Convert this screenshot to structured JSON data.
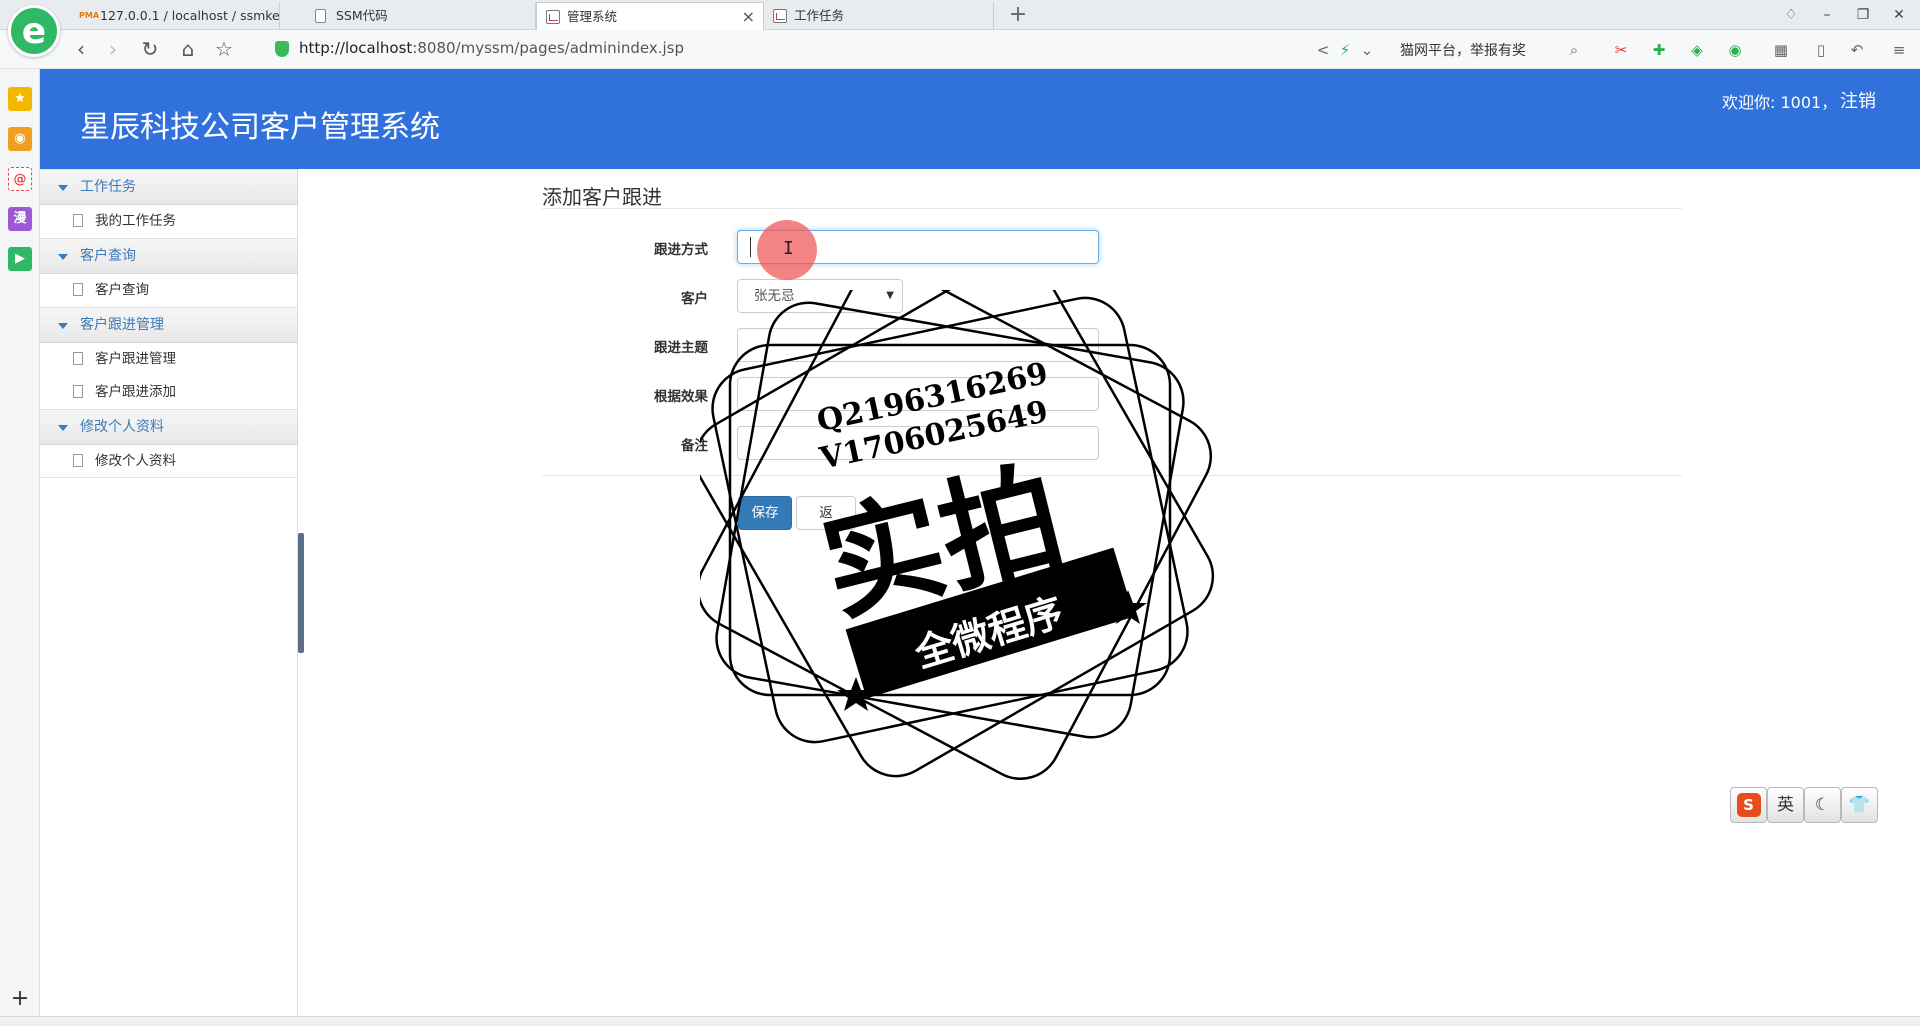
{
  "browser": {
    "tabs": [
      {
        "label": "127.0.0.1 / localhost / ssmkeh"
      },
      {
        "label": "SSM代码"
      },
      {
        "label": "管理系统"
      },
      {
        "label": "工作任务"
      }
    ],
    "url_host": "http://localhost",
    "url_rest": ":8080/myssm/pages/adminindex.jsp",
    "search_placeholder": "猫网平台，举报有奖"
  },
  "app": {
    "title": "星辰科技公司客户管理系统",
    "welcome": "欢迎你: 1001，",
    "logout": "注销",
    "accent": "#3071dc"
  },
  "menu": [
    {
      "group": "工作任务",
      "items": [
        "我的工作任务"
      ]
    },
    {
      "group": "客户查询",
      "items": [
        "客户查询"
      ]
    },
    {
      "group": "客户跟进管理",
      "items": [
        "客户跟进管理",
        "客户跟进添加"
      ]
    },
    {
      "group": "修改个人资料",
      "items": [
        "修改个人资料"
      ]
    }
  ],
  "form": {
    "title": "添加客户跟进",
    "labels": {
      "method": "跟进方式",
      "customer": "客户",
      "subject": "跟进主题",
      "effect": "根据效果",
      "remark": "备注"
    },
    "customer_selected": "张无忌",
    "save": "保存",
    "back": "返"
  },
  "watermark": {
    "line1": "Q2196316269",
    "line2": "V1706025649",
    "big": "实拍",
    "banner": "全微程序"
  },
  "ime": {
    "lang": "英"
  }
}
